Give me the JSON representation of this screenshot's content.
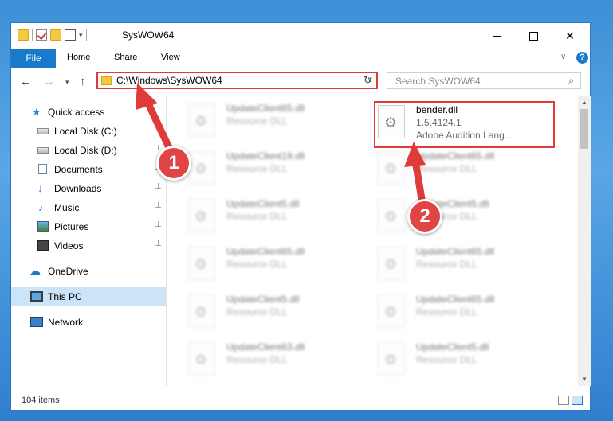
{
  "window": {
    "title": "SysWOW64",
    "minimize_glyph": "",
    "maximize_glyph": "",
    "close_glyph": "✕"
  },
  "ribbon": {
    "tabs": [
      "File",
      "Home",
      "Share",
      "View"
    ],
    "help_glyph": "?",
    "expand_glyph": "∨"
  },
  "nav": {
    "back_glyph": "←",
    "forward_glyph": "→",
    "recent_glyph": "▾",
    "up_glyph": "↑",
    "address": "C:\\Windows\\SysWOW64",
    "dropdown_glyph": "∨",
    "refresh_glyph": "↻",
    "search_placeholder": "Search SysWOW64",
    "search_glyph": "⌕"
  },
  "sidebar": {
    "items": [
      {
        "label": "Quick access",
        "icon": "star-icon",
        "pinned": false
      },
      {
        "label": "Local Disk (C:)",
        "icon": "drive-icon",
        "pinned": true
      },
      {
        "label": "Local Disk (D:)",
        "icon": "drive-icon",
        "pinned": true
      },
      {
        "label": "Documents",
        "icon": "documents-icon",
        "pinned": true
      },
      {
        "label": "Downloads",
        "icon": "downloads-icon",
        "pinned": true
      },
      {
        "label": "Music",
        "icon": "music-icon",
        "pinned": true
      },
      {
        "label": "Pictures",
        "icon": "pictures-icon",
        "pinned": true
      },
      {
        "label": "Videos",
        "icon": "videos-icon",
        "pinned": true
      },
      {
        "label": "OneDrive",
        "icon": "onedrive-icon",
        "pinned": false
      },
      {
        "label": "This PC",
        "icon": "this-pc-icon",
        "pinned": false,
        "selected": true
      },
      {
        "label": "Network",
        "icon": "network-icon",
        "pinned": false
      }
    ],
    "pin_glyph": "📌"
  },
  "files": {
    "left_column": [
      {
        "name": "UpdateClient65.dll",
        "type": "Resource DLL"
      },
      {
        "name": "UpdateClient19.dll",
        "type": "Resource DLL"
      },
      {
        "name": "UpdateClient5.dll",
        "type": "Resource DLL"
      },
      {
        "name": "UpdateClient65.dll",
        "type": "Resource DLL"
      },
      {
        "name": "UpdateClient5.dll",
        "type": "Resource DLL"
      },
      {
        "name": "UpdateClient63.dll",
        "type": "Resource DLL"
      }
    ],
    "right_column": [
      {
        "name": "bender.dll",
        "type": "1.5.4124.1",
        "desc": "Adobe Audition Lang..."
      },
      {
        "name": "UpdateClient65.dll",
        "type": "Resource DLL"
      },
      {
        "name": "UpdateClient5.dll",
        "type": "Resource DLL"
      },
      {
        "name": "UpdateClient65.dll",
        "type": "Resource DLL"
      },
      {
        "name": "UpdateClient65.dll",
        "type": "Resource DLL"
      },
      {
        "name": "UpdateClient5.dll",
        "type": "Resource DLL"
      }
    ]
  },
  "status": {
    "item_count": "104 items"
  },
  "annotations": {
    "badge1": "1",
    "badge2": "2",
    "arrow_color": "#e03b3b"
  },
  "colors": {
    "accent": "#1979ca",
    "highlight": "#e03b3b",
    "selected_bg": "#cce4f7"
  }
}
